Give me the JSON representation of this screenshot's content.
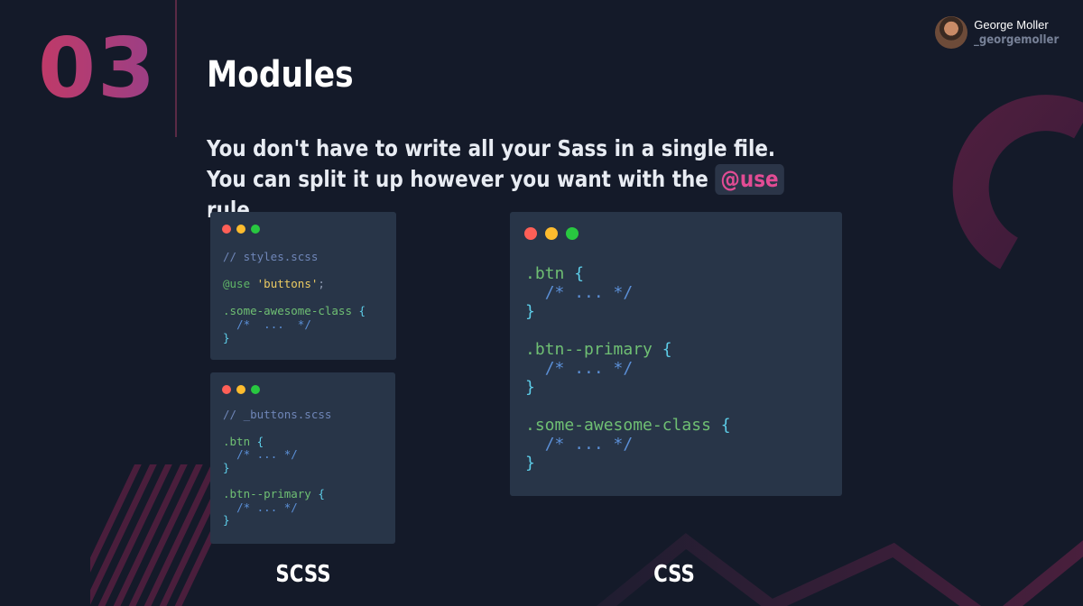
{
  "slide": {
    "number": "03",
    "title": "Modules",
    "subtitle_before": "You don't have to write all your Sass in a single file. You can split it up however you want with the",
    "subtitle_code": "@use",
    "subtitle_after": "rule."
  },
  "author": {
    "name": "George Moller",
    "handle": "_georgemoller"
  },
  "windows": {
    "styles": {
      "comment": "// styles.scss",
      "at_rule": "@use",
      "string": "'buttons'",
      "semicolon": ";",
      "selector": ".some-awesome-class",
      "open": "{",
      "inner": "/*  ...  */",
      "close": "}"
    },
    "buttons": {
      "comment": "// _buttons.scss",
      "sel1": ".btn",
      "sel2": ".btn--primary",
      "open": "{",
      "inner": "/* ... */",
      "close": "}"
    },
    "css": {
      "sel1": ".btn",
      "sel2": ".btn--primary",
      "sel3": ".some-awesome-class",
      "open": "{",
      "inner": "/* ... */",
      "close": "}"
    }
  },
  "labels": {
    "scss": "SCSS",
    "css": "CSS"
  },
  "colors": {
    "background": "#141a29",
    "window": "#283548",
    "accent": "#e24c94",
    "number_gradient_start": "#c03a68",
    "number_gradient_end": "#9a3f86",
    "dot_red": "#fe5f57",
    "dot_yellow": "#febc2e",
    "dot_green": "#28c840"
  },
  "icons": [
    "window-close-dot-icon",
    "window-minimize-dot-icon",
    "window-maximize-dot-icon"
  ]
}
